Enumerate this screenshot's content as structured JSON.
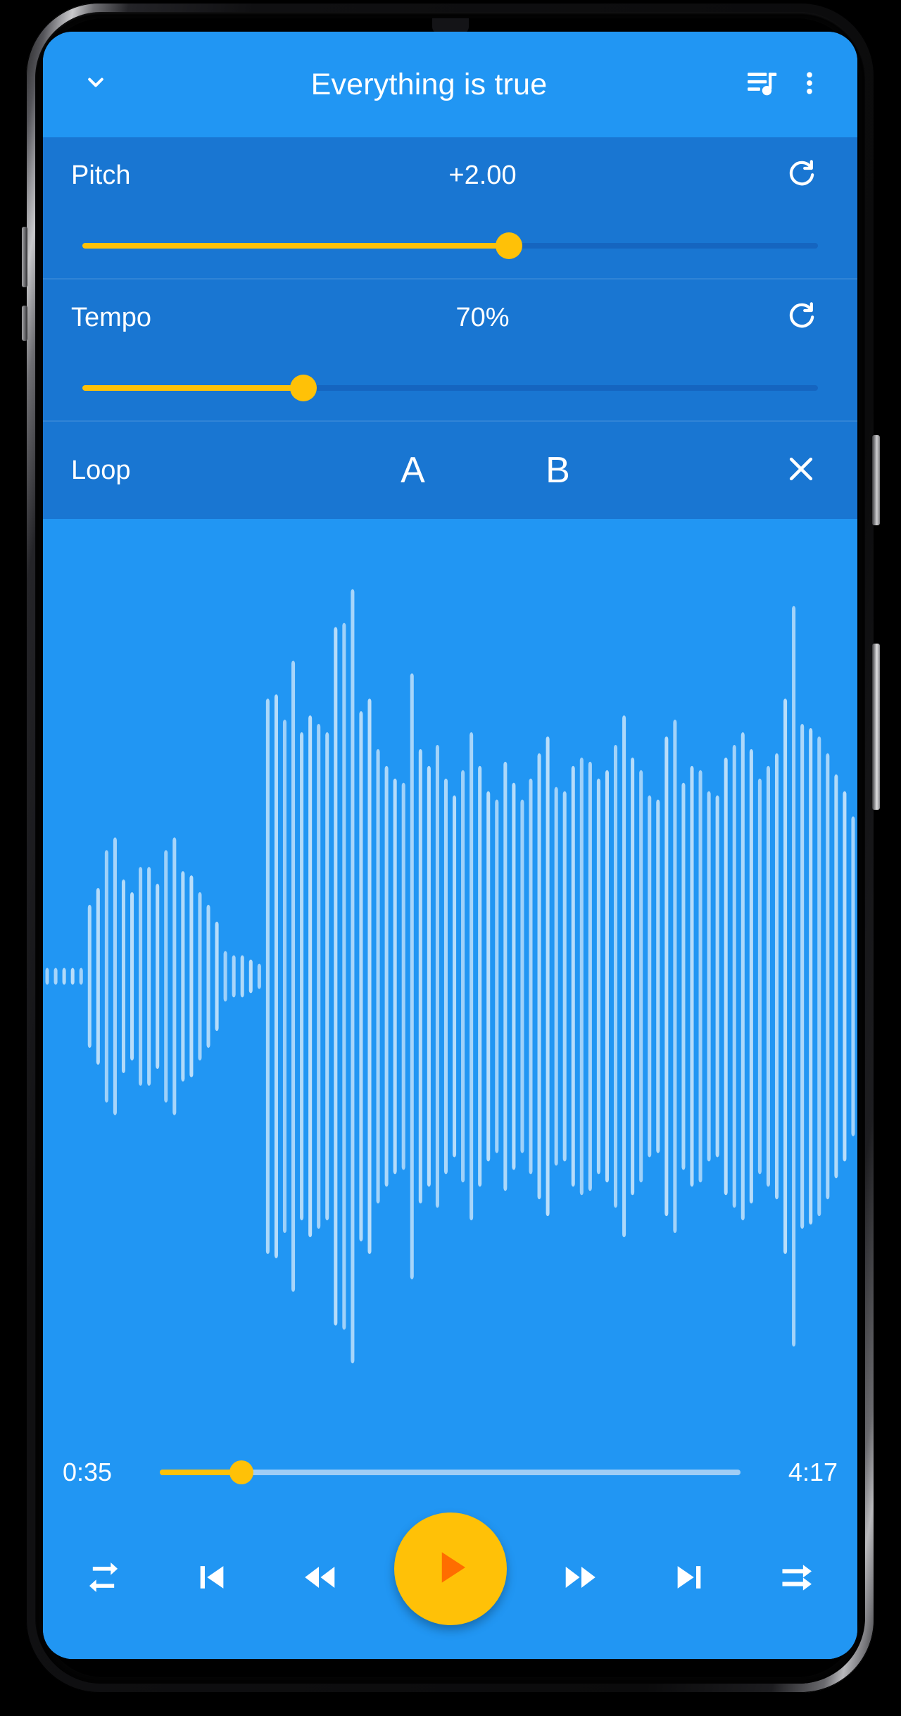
{
  "app_bar": {
    "collapse_icon": "chevron-down-icon",
    "title": "Everything is true",
    "queue_icon": "queue-music-icon",
    "menu_icon": "more-vert-icon"
  },
  "controls": {
    "pitch": {
      "label": "Pitch",
      "value": "+2.00",
      "reset_icon": "refresh-icon",
      "slider_percent": 58
    },
    "tempo": {
      "label": "Tempo",
      "value": "70%",
      "reset_icon": "refresh-icon",
      "slider_percent": 30
    },
    "loop": {
      "label": "Loop",
      "a_label": "A",
      "b_label": "B",
      "clear_icon": "close-icon"
    }
  },
  "seek": {
    "current_time": "0:35",
    "total_time": "4:17",
    "progress_percent": 14
  },
  "transport": {
    "repeat_icon": "repeat-icon",
    "previous_icon": "skip-previous-icon",
    "rewind_icon": "fast-rewind-icon",
    "play_icon": "play-arrow-icon",
    "forward_icon": "fast-forward-icon",
    "next_icon": "skip-next-icon",
    "shuffle_icon": "shuffle-icon"
  },
  "colors": {
    "primary": "#2196f3",
    "primary_dark": "#1976d2",
    "track_dark": "#1565c0",
    "accent": "#ffc107",
    "play_glyph": "#ff6d00",
    "on_primary": "#ffffff",
    "seek_track": "#9fcdf5",
    "waveform": "#bfe0fa"
  },
  "waveform": {
    "bar_count": 96,
    "amplitudes": [
      0.02,
      0.02,
      0.02,
      0.02,
      0.02,
      0.17,
      0.21,
      0.3,
      0.33,
      0.23,
      0.2,
      0.26,
      0.26,
      0.22,
      0.3,
      0.33,
      0.25,
      0.24,
      0.2,
      0.17,
      0.13,
      0.06,
      0.05,
      0.05,
      0.04,
      0.03,
      0.66,
      0.67,
      0.61,
      0.75,
      0.58,
      0.62,
      0.6,
      0.58,
      0.83,
      0.84,
      0.92,
      0.63,
      0.66,
      0.54,
      0.5,
      0.47,
      0.46,
      0.72,
      0.54,
      0.5,
      0.55,
      0.47,
      0.43,
      0.49,
      0.58,
      0.5,
      0.44,
      0.42,
      0.51,
      0.46,
      0.42,
      0.47,
      0.53,
      0.57,
      0.45,
      0.44,
      0.5,
      0.52,
      0.51,
      0.47,
      0.49,
      0.55,
      0.62,
      0.52,
      0.49,
      0.43,
      0.42,
      0.57,
      0.61,
      0.46,
      0.5,
      0.49,
      0.44,
      0.43,
      0.52,
      0.55,
      0.58,
      0.54,
      0.47,
      0.5,
      0.53,
      0.66,
      0.88,
      0.6,
      0.59,
      0.57,
      0.53,
      0.48,
      0.44,
      0.38
    ]
  }
}
